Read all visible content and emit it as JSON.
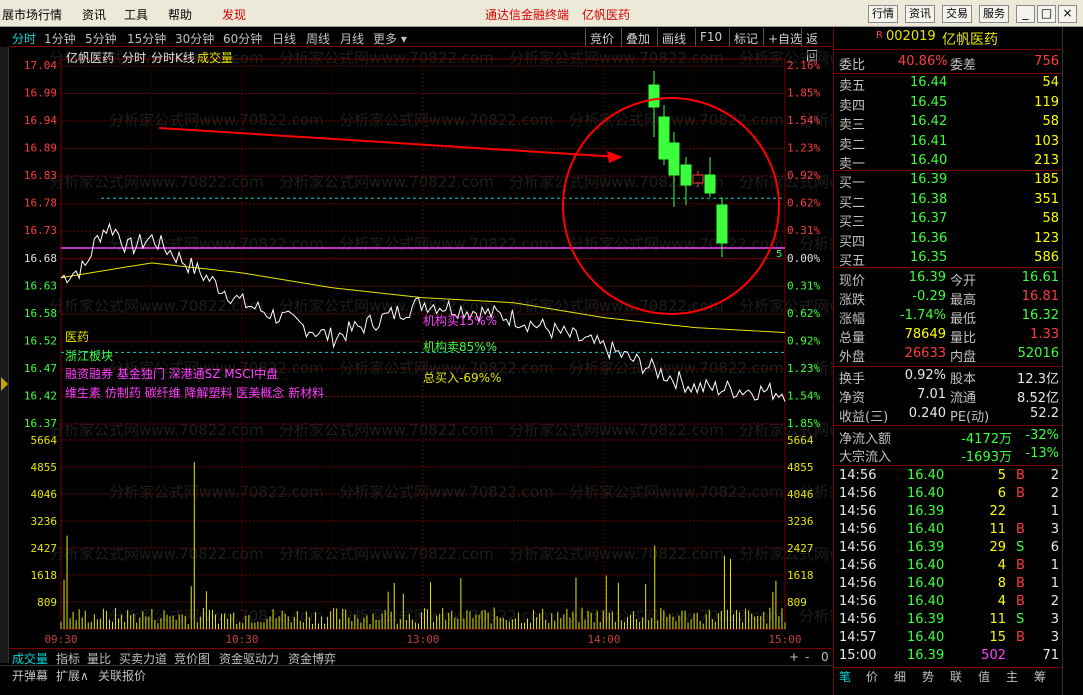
{
  "menubar": {
    "items": [
      "展市场行情",
      "资讯",
      "工具",
      "帮助"
    ],
    "highlight": "发现",
    "center_link1": "通达信金融终端",
    "center_link2": "亿帆医药",
    "right_buttons": [
      "行情",
      "资讯",
      "交易",
      "服务"
    ],
    "win_buttons": [
      "_",
      "□",
      "×"
    ]
  },
  "toolbar": {
    "periods": [
      "分时",
      "1分钟",
      "5分钟",
      "15分钟",
      "30分钟",
      "60分钟",
      "日线",
      "周线",
      "月线",
      "更多 ▾"
    ],
    "active_period": 0,
    "right_buttons": [
      "竞价",
      "叠加",
      "画线",
      "F10",
      "标记",
      "+自选",
      "返回"
    ]
  },
  "chart": {
    "header": {
      "name": "亿帆医药",
      "t1": "分时",
      "t2": "分时K线",
      "t3": "成交量"
    },
    "price_labels": [
      "17.04",
      "16.99",
      "16.94",
      "16.89",
      "16.83",
      "16.78",
      "16.73",
      "16.68",
      "16.63",
      "16.58",
      "16.52",
      "16.47",
      "16.42",
      "16.37"
    ],
    "pct_labels": [
      "2.16%",
      "1.85%",
      "1.54%",
      "1.23%",
      "0.92%",
      "0.62%",
      "0.31%",
      "0.00%",
      "0.31%",
      "0.62%",
      "0.92%",
      "1.23%",
      "1.54%",
      "1.85%"
    ],
    "vol_labels": [
      "5664",
      "4855",
      "4046",
      "3236",
      "2427",
      "1618",
      "809"
    ],
    "time_labels": [
      "09:30",
      "10:30",
      "13:00",
      "14:00",
      "15:00"
    ],
    "zero_mark": "5",
    "annotations": {
      "sector1": "医药",
      "sector2": "浙江板块",
      "concepts1": "融资融券 基金独门 深港通SZ MSCI中盘",
      "concepts2": "维生素 仿制药 碳纤维 降解塑料 医美概念 新材料",
      "inst_buy": "机构买15%%",
      "inst_sell": "机构卖85%%",
      "total_buy": "总买入-69%%"
    },
    "watermark": "分析家公式网www.70822.com",
    "colors": {
      "price_line": "#ffffff",
      "avg_line": "#e6e600",
      "prev_close": "#ff40ff",
      "up": "#ff3c3c",
      "down": "#3cff3c",
      "volume": "#e6e600",
      "grid": "#7a0000",
      "circle": "#ff0000"
    }
  },
  "chart_data": [
    {
      "type": "line",
      "title": "",
      "xlabel": "",
      "ylabel": "",
      "x": [
        "09:30",
        "10:00",
        "10:30",
        "11:00",
        "11:30/13:00",
        "13:30",
        "14:00",
        "14:30",
        "15:00"
      ],
      "series": [
        {
          "name": "",
          "values": [
            16.62,
            16.7,
            16.57,
            16.5,
            16.57,
            16.54,
            16.48,
            16.4,
            16.39
          ]
        },
        {
          "name": "",
          "values": [
            16.62,
            16.65,
            16.63,
            16.6,
            16.58,
            16.57,
            16.54,
            16.52,
            16.51
          ]
        }
      ],
      "prev_close": 16.68,
      "ylim": [
        16.32,
        17.04
      ]
    },
    {
      "type": "bar",
      "title": "",
      "ylim": [
        0,
        5664
      ],
      "x": [
        "09:30",
        "10:30",
        "13:00",
        "14:00",
        "15:00"
      ],
      "values": [
        800,
        5000,
        1200,
        2400,
        2200
      ]
    }
  ],
  "bottom_tabs": [
    "成交量",
    "指标",
    "量比",
    "买卖力道",
    "竞价图",
    "资金驱动力",
    "资金博弈"
  ],
  "bottom_controls": [
    "+",
    "-",
    "0"
  ],
  "status": [
    "开弹幕",
    "扩展∧",
    "关联报价"
  ],
  "quote": {
    "code_prefix": "R",
    "code": "002019",
    "name": "亿帆医药",
    "weibi_label": "委比",
    "weibi": "40.86%",
    "weicha_label": "委差",
    "weicha": "756",
    "asks": [
      {
        "label": "卖五",
        "price": "16.44",
        "vol": "54"
      },
      {
        "label": "卖四",
        "price": "16.45",
        "vol": "119"
      },
      {
        "label": "卖三",
        "price": "16.42",
        "vol": "58"
      },
      {
        "label": "卖二",
        "price": "16.41",
        "vol": "103"
      },
      {
        "label": "卖一",
        "price": "16.40",
        "vol": "213"
      }
    ],
    "bids": [
      {
        "label": "买一",
        "price": "16.39",
        "vol": "185"
      },
      {
        "label": "买二",
        "price": "16.38",
        "vol": "351"
      },
      {
        "label": "买三",
        "price": "16.37",
        "vol": "58"
      },
      {
        "label": "买四",
        "price": "16.36",
        "vol": "123"
      },
      {
        "label": "买五",
        "price": "16.35",
        "vol": "586"
      }
    ],
    "stats": [
      {
        "l1": "现价",
        "v1": "16.39",
        "c1": "grn",
        "l2": "今开",
        "v2": "16.61",
        "c2": "grn"
      },
      {
        "l1": "涨跌",
        "v1": "-0.29",
        "c1": "grn",
        "l2": "最高",
        "v2": "16.81",
        "c2": "red"
      },
      {
        "l1": "涨幅",
        "v1": "-1.74%",
        "c1": "grn",
        "l2": "最低",
        "v2": "16.32",
        "c2": "grn"
      },
      {
        "l1": "总量",
        "v1": "78649",
        "c1": "yel",
        "l2": "量比",
        "v2": "1.33",
        "c2": "red"
      },
      {
        "l1": "外盘",
        "v1": "26633",
        "c1": "red",
        "l2": "内盘",
        "v2": "52016",
        "c2": "grn"
      }
    ],
    "stats2": [
      {
        "l1": "换手",
        "v1": "0.92%",
        "c1": "wht",
        "l2": "股本",
        "v2": "12.3亿",
        "c2": "wht"
      },
      {
        "l1": "净资",
        "v1": "7.01",
        "c1": "wht",
        "l2": "流通",
        "v2": "8.52亿",
        "c2": "wht"
      },
      {
        "l1": "收益(三)",
        "v1": "0.240",
        "c1": "wht",
        "l2": "PE(动)",
        "v2": "52.2",
        "c2": "wht"
      }
    ],
    "flow": [
      {
        "label": "净流入额",
        "val": "-4172万",
        "pct": "-32%"
      },
      {
        "label": "大宗流入",
        "val": "-1693万",
        "pct": "-13%"
      }
    ],
    "ticks": [
      {
        "t": "14:56",
        "p": "16.40",
        "pc": "grn",
        "v": "5",
        "s": "B",
        "sc": "red",
        "n": "2"
      },
      {
        "t": "14:56",
        "p": "16.40",
        "pc": "grn",
        "v": "6",
        "s": "B",
        "sc": "red",
        "n": "2"
      },
      {
        "t": "14:56",
        "p": "16.39",
        "pc": "grn",
        "v": "22",
        "s": "",
        "sc": "",
        "n": "1"
      },
      {
        "t": "14:56",
        "p": "16.40",
        "pc": "grn",
        "v": "11",
        "s": "B",
        "sc": "red",
        "n": "3"
      },
      {
        "t": "14:56",
        "p": "16.39",
        "pc": "grn",
        "v": "29",
        "s": "S",
        "sc": "grn",
        "n": "6"
      },
      {
        "t": "14:56",
        "p": "16.40",
        "pc": "grn",
        "v": "4",
        "s": "B",
        "sc": "red",
        "n": "1"
      },
      {
        "t": "14:56",
        "p": "16.40",
        "pc": "grn",
        "v": "8",
        "s": "B",
        "sc": "red",
        "n": "1"
      },
      {
        "t": "14:56",
        "p": "16.40",
        "pc": "grn",
        "v": "4",
        "s": "B",
        "sc": "red",
        "n": "2"
      },
      {
        "t": "14:56",
        "p": "16.39",
        "pc": "grn",
        "v": "11",
        "s": "S",
        "sc": "grn",
        "n": "3"
      },
      {
        "t": "14:57",
        "p": "16.40",
        "pc": "grn",
        "v": "15",
        "s": "B",
        "sc": "red",
        "n": "3"
      },
      {
        "t": "15:00",
        "p": "16.39",
        "pc": "grn",
        "v": "502",
        "s": "",
        "sc": "mag",
        "n": "71"
      }
    ],
    "bottom_tabs": [
      "笔",
      "价",
      "细",
      "势",
      "联",
      "值",
      "主",
      "筹"
    ]
  }
}
